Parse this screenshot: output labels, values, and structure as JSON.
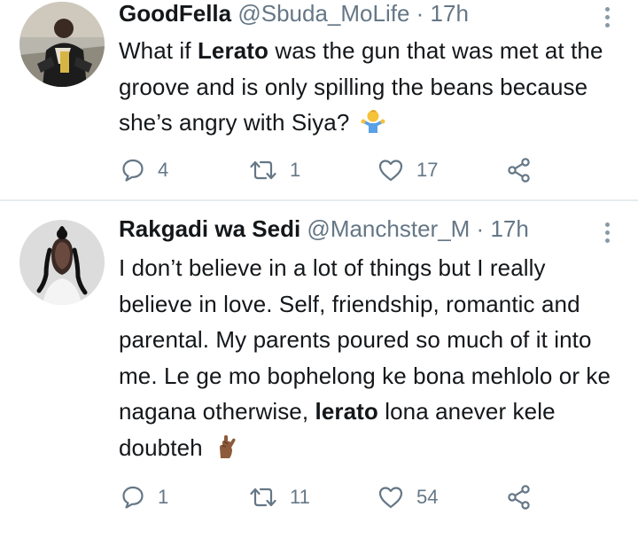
{
  "tweets": [
    {
      "name": "GoodFella",
      "handle": "@Sbuda_MoLife",
      "separator": " · ",
      "time": "17h",
      "text_parts": [
        "What if ",
        "Lerato",
        " was the gun that was met at the groove and is only spilling the beans because she’s angry with Siya? "
      ],
      "emoji_icon": "person-shrugging-icon",
      "replies": "4",
      "retweets": "1",
      "likes": "17"
    },
    {
      "name": "Rakgadi wa Sedi",
      "handle": "@Manchster_M",
      "separator": " · ",
      "time": "17h",
      "text_parts": [
        "I don’t believe in a lot of things but I really believe in love. Self, friendship, romantic and parental. My parents poured so much of it into me. Le ge mo bophelong ke bona mehlolo or ke nagana otherwise, ",
        "lerato",
        " lona anever kele doubteh "
      ],
      "emoji_icon": "crossed-fingers-icon",
      "replies": "1",
      "retweets": "11",
      "likes": "54"
    }
  ],
  "colors": {
    "text": "#14171a",
    "secondary": "#657786",
    "divider": "#e6ecf0"
  }
}
